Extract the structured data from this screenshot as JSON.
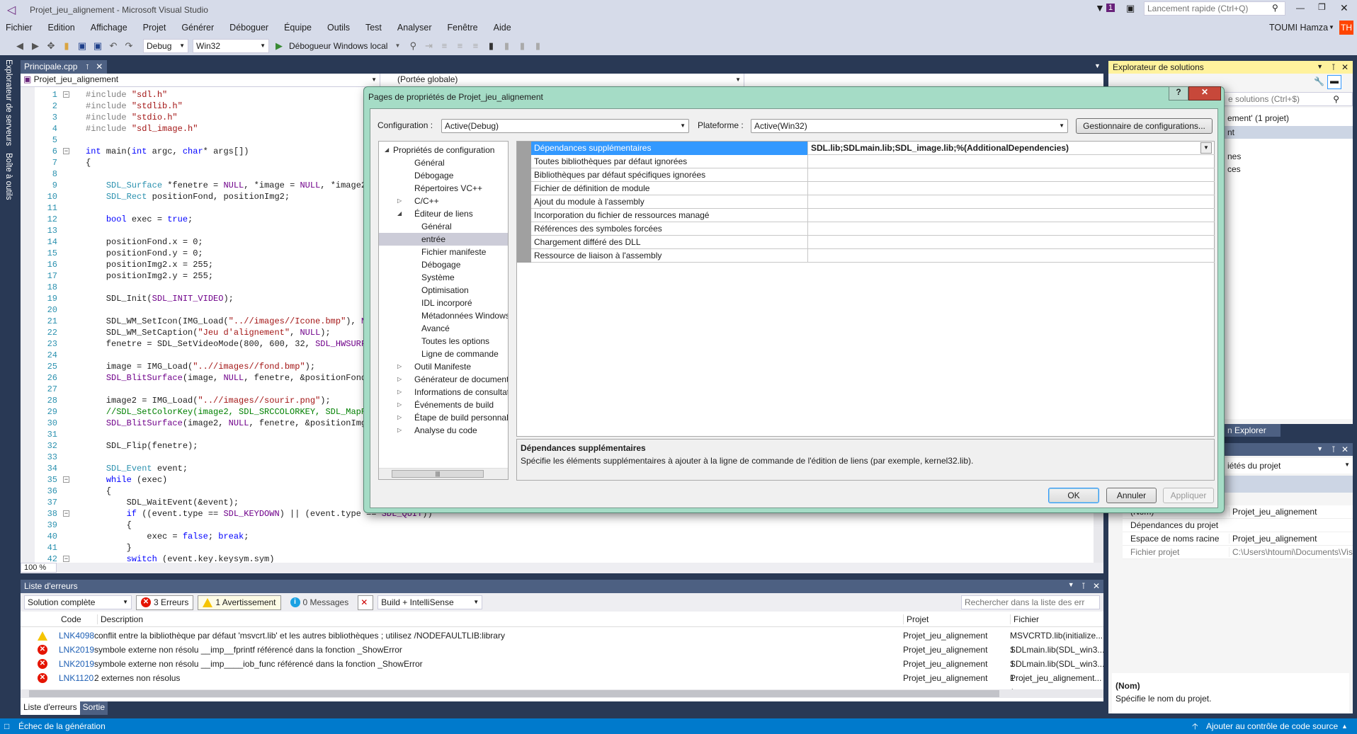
{
  "window": {
    "title": "Projet_jeu_alignement - Microsoft Visual Studio",
    "notif_count": "1",
    "quick_launch_placeholder": "Lancement rapide (Ctrl+Q)",
    "user": "TOUMI Hamza",
    "user_initials": "TH",
    "user_color": "#ff4500"
  },
  "menu": [
    "Fichier",
    "Edition",
    "Affichage",
    "Projet",
    "Générer",
    "Déboguer",
    "Équipe",
    "Outils",
    "Test",
    "Analyser",
    "Fenêtre",
    "Aide"
  ],
  "toolbar": {
    "config": "Debug",
    "platform": "Win32",
    "debugger": "Débogueur Windows local"
  },
  "side_tabs": [
    "Explorateur de serveurs",
    "Boîte à outils"
  ],
  "editor": {
    "tab": "Principale.cpp",
    "nav_project": "Projet_jeu_alignement",
    "nav_scope": "(Portée globale)",
    "zoom": "100 %",
    "lines": [
      [
        [
          "p",
          "#include "
        ],
        [
          "s",
          "\"sdl.h\""
        ]
      ],
      [
        [
          "p",
          "#include "
        ],
        [
          "s",
          "\"stdlib.h\""
        ]
      ],
      [
        [
          "p",
          "#include "
        ],
        [
          "s",
          "\"stdio.h\""
        ]
      ],
      [
        [
          "p",
          "#include "
        ],
        [
          "s",
          "\"sdl_image.h\""
        ]
      ],
      [],
      [
        [
          "k",
          "int"
        ],
        [
          "n",
          " main("
        ],
        [
          "k",
          "int"
        ],
        [
          "n",
          " argc, "
        ],
        [
          "k",
          "char"
        ],
        [
          "n",
          "* args[])"
        ]
      ],
      [
        [
          "n",
          "{"
        ]
      ],
      [],
      [
        [
          "n",
          "    "
        ],
        [
          "t",
          "SDL_Surface"
        ],
        [
          "n",
          " *fenetre = "
        ],
        [
          "m",
          "NULL"
        ],
        [
          "n",
          ", *image = "
        ],
        [
          "m",
          "NULL"
        ],
        [
          "n",
          ", *image2"
        ]
      ],
      [
        [
          "n",
          "    "
        ],
        [
          "t",
          "SDL_Rect"
        ],
        [
          "n",
          " positionFond, positionImg2;"
        ]
      ],
      [],
      [
        [
          "n",
          "    "
        ],
        [
          "k",
          "bool"
        ],
        [
          "n",
          " exec = "
        ],
        [
          "k",
          "true"
        ],
        [
          "n",
          ";"
        ]
      ],
      [],
      [
        [
          "n",
          "    positionFond.x = 0;"
        ]
      ],
      [
        [
          "n",
          "    positionFond.y = 0;"
        ]
      ],
      [
        [
          "n",
          "    positionImg2.x = 255;"
        ]
      ],
      [
        [
          "n",
          "    positionImg2.y = 255;"
        ]
      ],
      [],
      [
        [
          "n",
          "    SDL_Init("
        ],
        [
          "m",
          "SDL_INIT_VIDEO"
        ],
        [
          "n",
          ");"
        ]
      ],
      [],
      [
        [
          "n",
          "    SDL_WM_SetIcon(IMG_Load("
        ],
        [
          "s",
          "\"..//images//Icone.bmp\""
        ],
        [
          "n",
          "), "
        ],
        [
          "m",
          "NU"
        ]
      ],
      [
        [
          "n",
          "    SDL_WM_SetCaption("
        ],
        [
          "s",
          "\"Jeu d'alignement\""
        ],
        [
          "n",
          ", "
        ],
        [
          "m",
          "NULL"
        ],
        [
          "n",
          ");"
        ]
      ],
      [
        [
          "n",
          "    fenetre = SDL_SetVideoMode(800, 600, 32, "
        ],
        [
          "m",
          "SDL_HWSURFA"
        ]
      ],
      [],
      [
        [
          "n",
          "    image = IMG_Load("
        ],
        [
          "s",
          "\"..//images//fond.bmp\""
        ],
        [
          "n",
          ");"
        ]
      ],
      [
        [
          "n",
          "    "
        ],
        [
          "m",
          "SDL_BlitSurface"
        ],
        [
          "n",
          "(image, "
        ],
        [
          "m",
          "NULL"
        ],
        [
          "n",
          ", fenetre, &positionFond)"
        ]
      ],
      [],
      [
        [
          "n",
          "    image2 = IMG_Load("
        ],
        [
          "s",
          "\"..//images//sourir.png\""
        ],
        [
          "n",
          ");"
        ]
      ],
      [
        [
          "n",
          "    "
        ],
        [
          "c",
          "//SDL_SetColorKey(image2, SDL_SRCCOLORKEY, SDL_MapRG"
        ]
      ],
      [
        [
          "n",
          "    "
        ],
        [
          "m",
          "SDL_BlitSurface"
        ],
        [
          "n",
          "(image2, "
        ],
        [
          "m",
          "NULL"
        ],
        [
          "n",
          ", fenetre, &positionImg2"
        ]
      ],
      [],
      [
        [
          "n",
          "    SDL_Flip(fenetre);"
        ]
      ],
      [],
      [
        [
          "n",
          "    "
        ],
        [
          "t",
          "SDL_Event"
        ],
        [
          "n",
          " event;"
        ]
      ],
      [
        [
          "n",
          "    "
        ],
        [
          "k",
          "while"
        ],
        [
          "n",
          " (exec)"
        ]
      ],
      [
        [
          "n",
          "    {"
        ]
      ],
      [
        [
          "n",
          "        SDL_WaitEvent(&event);"
        ]
      ],
      [
        [
          "n",
          "        "
        ],
        [
          "k",
          "if"
        ],
        [
          "n",
          " ((event.type == "
        ],
        [
          "m",
          "SDL_KEYDOWN"
        ],
        [
          "n",
          ") || (event.type == "
        ],
        [
          "m",
          "SDL_QUIT"
        ],
        [
          "n",
          "))"
        ]
      ],
      [
        [
          "n",
          "        {"
        ]
      ],
      [
        [
          "n",
          "            exec = "
        ],
        [
          "k",
          "false"
        ],
        [
          "n",
          "; "
        ],
        [
          "k",
          "break"
        ],
        [
          "n",
          ";"
        ]
      ],
      [
        [
          "n",
          "        }"
        ]
      ],
      [
        [
          "n",
          "        "
        ],
        [
          "k",
          "switch"
        ],
        [
          "n",
          " (event.key.keysym.sym)"
        ]
      ]
    ]
  },
  "dialog": {
    "title": "Pages de propriétés de Projet_jeu_alignement",
    "config_label": "Configuration :",
    "config_value": "Active(Debug)",
    "platform_label": "Plateforme :",
    "platform_value": "Active(Win32)",
    "config_manager": "Gestionnaire de configurations...",
    "tree": [
      {
        "label": "Propriétés de configuration",
        "level": 0,
        "exp": "open"
      },
      {
        "label": "Général",
        "level": 1
      },
      {
        "label": "Débogage",
        "level": 1
      },
      {
        "label": "Répertoires VC++",
        "level": 1
      },
      {
        "label": "C/C++",
        "level": 1,
        "exp": "closed"
      },
      {
        "label": "Éditeur de liens",
        "level": 1,
        "exp": "open"
      },
      {
        "label": "Général",
        "level": 2
      },
      {
        "label": "entrée",
        "level": 2,
        "selected": true
      },
      {
        "label": "Fichier manifeste",
        "level": 2
      },
      {
        "label": "Débogage",
        "level": 2
      },
      {
        "label": "Système",
        "level": 2
      },
      {
        "label": "Optimisation",
        "level": 2
      },
      {
        "label": "IDL incorporé",
        "level": 2
      },
      {
        "label": "Métadonnées Windows",
        "level": 2
      },
      {
        "label": "Avancé",
        "level": 2
      },
      {
        "label": "Toutes les options",
        "level": 2
      },
      {
        "label": "Ligne de commande",
        "level": 2
      },
      {
        "label": "Outil Manifeste",
        "level": 1,
        "exp": "closed"
      },
      {
        "label": "Générateur de document XML",
        "level": 1,
        "exp": "closed"
      },
      {
        "label": "Informations de consultation",
        "level": 1,
        "exp": "closed"
      },
      {
        "label": "Événements de build",
        "level": 1,
        "exp": "closed"
      },
      {
        "label": "Étape de build personnalisée",
        "level": 1,
        "exp": "closed"
      },
      {
        "label": "Analyse du code",
        "level": 1,
        "exp": "closed"
      }
    ],
    "grid": [
      {
        "name": "Dépendances supplémentaires",
        "value": "SDL.lib;SDLmain.lib;SDL_image.lib;%(AdditionalDependencies)"
      },
      {
        "name": "Toutes bibliothèques par défaut ignorées",
        "value": ""
      },
      {
        "name": "Bibliothèques par défaut spécifiques ignorées",
        "value": ""
      },
      {
        "name": "Fichier de définition de module",
        "value": ""
      },
      {
        "name": "Ajout du module à l'assembly",
        "value": ""
      },
      {
        "name": "Incorporation du fichier de ressources managé",
        "value": ""
      },
      {
        "name": "Références des symboles forcées",
        "value": ""
      },
      {
        "name": "Chargement différé des DLL",
        "value": ""
      },
      {
        "name": "Ressource de liaison à l'assembly",
        "value": ""
      }
    ],
    "desc_title": "Dépendances supplémentaires",
    "desc_text": "Spécifie les éléments supplémentaires à ajouter à la ligne de commande de l'édition de liens (par exemple, kernel32.lib).",
    "ok": "OK",
    "cancel": "Annuler",
    "apply": "Appliquer"
  },
  "solution_explorer": {
    "title": "Explorateur de solutions",
    "search_fragment": "e solutions (Ctrl+$)",
    "items": [
      "ement' (1 projet)",
      "nt",
      "nes",
      "ces"
    ],
    "tab_fragment": "n Explorer"
  },
  "properties": {
    "combo_fragment": "iétés du projet",
    "rows": [
      {
        "name": "(Nom)",
        "value": "Projet_jeu_alignement"
      },
      {
        "name": "Dépendances du projet",
        "value": ""
      },
      {
        "name": "Espace de noms racine",
        "value": "Projet_jeu_alignement"
      },
      {
        "name": "Fichier projet",
        "value": "C:\\Users\\htoumi\\Documents\\Vis"
      }
    ],
    "desc_title": "(Nom)",
    "desc_text": "Spécifie le nom du projet."
  },
  "errors": {
    "title": "Liste d'erreurs",
    "scope": "Solution complète",
    "errors_btn": "3 Erreurs",
    "warnings_btn": "1 Avertissement",
    "messages_btn": "0 Messages",
    "source": "Build + IntelliSense",
    "search_placeholder": "Rechercher dans la liste des err",
    "cols": {
      "code": "Code",
      "desc": "Description",
      "project": "Projet",
      "file": "Fichier"
    },
    "rows": [
      {
        "type": "warning",
        "code": "LNK4098",
        "desc": "conflit entre la bibliothèque par défaut 'msvcrt.lib' et les autres bibliothèques ; utilisez /NODEFAULTLIB:library",
        "project": "Projet_jeu_alignement",
        "file": "MSVCRTD.lib(initialize... 1"
      },
      {
        "type": "error",
        "code": "LNK2019",
        "desc": "symbole externe non résolu __imp__fprintf référencé dans la fonction _ShowError",
        "project": "Projet_jeu_alignement",
        "file": "SDLmain.lib(SDL_win3... 1"
      },
      {
        "type": "error",
        "code": "LNK2019",
        "desc": "symbole externe non résolu __imp____iob_func référencé dans la fonction _ShowError",
        "project": "Projet_jeu_alignement",
        "file": "SDLmain.lib(SDL_win3... 1"
      },
      {
        "type": "error",
        "code": "LNK1120",
        "desc": "2 externes non résolus",
        "project": "Projet_jeu_alignement",
        "file": "Projet_jeu_alignement... 1"
      }
    ],
    "tabs": [
      "Liste d'erreurs",
      "Sortie"
    ]
  },
  "status": {
    "left": "Échec de la génération",
    "right": "Ajouter au contrôle de code source"
  }
}
